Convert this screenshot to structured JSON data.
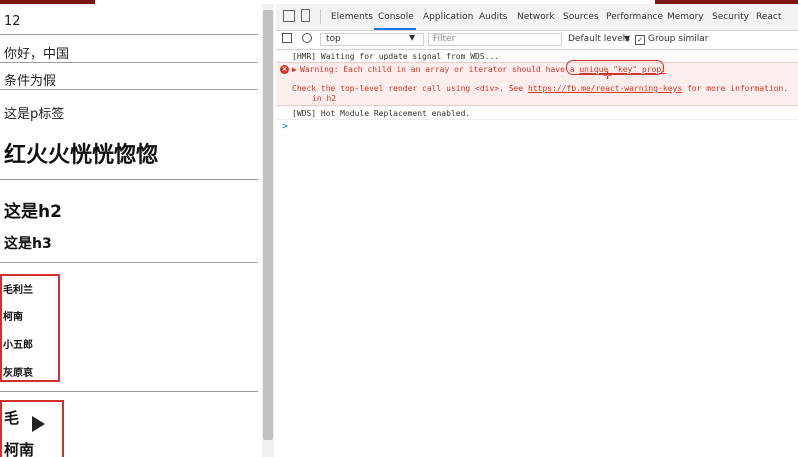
{
  "app": {
    "counter": "12",
    "greeting": "你好，中国",
    "condition": "条件为假",
    "p_label": "这是p标签",
    "big_heading": "红火火恍恍惚惚",
    "h2": "这是h2",
    "h3": "这是h3",
    "list1": [
      "毛利兰",
      "柯南",
      "小五郎",
      "灰原哀"
    ],
    "list2": [
      "毛",
      "柯南"
    ]
  },
  "devtools": {
    "tabs": [
      "Elements",
      "Console",
      "Application",
      "Audits",
      "Network",
      "Sources",
      "Performance",
      "Memory",
      "Security",
      "React"
    ],
    "active_tab": "Console",
    "toolbar": {
      "context": "top",
      "filter_placeholder": "Filter",
      "levels": "Default levels",
      "group_similar": "Group similar"
    },
    "messages": {
      "hmr": "[HMR] Waiting for update signal from WDS...",
      "warn_prefix": "Warning: Each child in an array or iterator should have a ",
      "warn_key": "unique \"key\" prop.",
      "warn_check_1": "Check the top-level render call using <div>. See ",
      "warn_link": "https://fb.me/react-warning-keys",
      "warn_check_2": " for more information.",
      "warn_in": "in h2",
      "wds": "[WDS] Hot Module Replacement enabled.",
      "prompt": ">"
    }
  },
  "colors": {
    "annotation_red": "#d2302b",
    "warning_text": "#d8352a",
    "warning_bg": "#fdeeee",
    "active_tab_underline": "#1a73e8"
  }
}
